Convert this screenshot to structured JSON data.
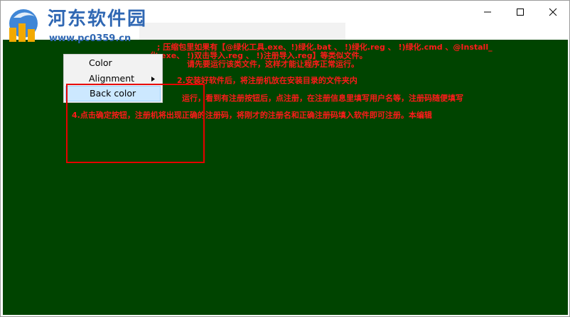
{
  "watermark": {
    "site_name": "河东软件园",
    "url": "www.pc0359.cn"
  },
  "window_controls": {
    "minimize_icon": "minimize-icon",
    "maximize_icon": "maximize-icon",
    "close_icon": "close-icon"
  },
  "content": {
    "background_color": "#004400",
    "text_color": "#ff1a1a",
    "lines": [
      "; 压缩包里如果有【@绿化工具.exe、!)绿化.bat 、 !)绿化.reg 、 !)绿化.cmd 、@Install_",
      "化.exe、 !)双击导入.reg 、 !)注册导入.reg】等类似文件。",
      "请先要运行该类文件，这样才能让程序正常运行。",
      "2.安装好软件后，将注册机放在安装目录的文件夹内",
      "运行，看到有注册按钮后，点注册，在注册信息里填写用户名等，注册码随便填写",
      "4.点击确定按钮，注册机将出现正确的注册码，将刚才的注册名和正确注册码填入软件即可注册。本编辑"
    ]
  },
  "context_menu": {
    "items": [
      {
        "label": "Color"
      },
      {
        "label": "Alignment",
        "has_submenu": true
      },
      {
        "label": "Back color",
        "highlighted": true
      }
    ]
  },
  "colors": {
    "menu_highlight": "#cce8ff",
    "annotation_box": "#e60000",
    "logo_blue": "#2f67b3"
  }
}
